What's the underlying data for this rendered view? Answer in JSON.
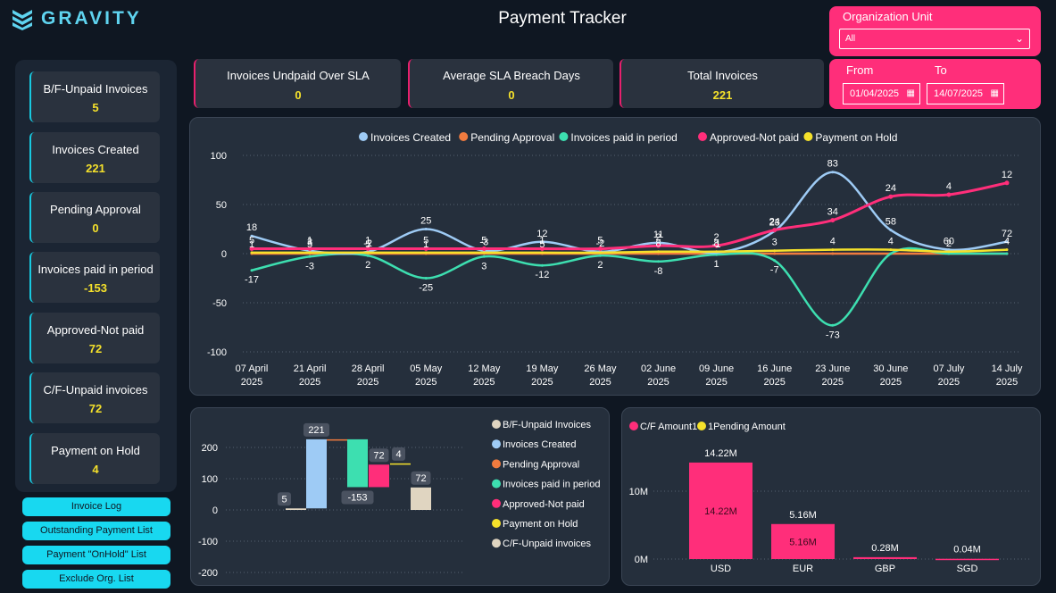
{
  "brand": {
    "name": "GRAVITY"
  },
  "title": "Payment Tracker",
  "sidebar_kpis": [
    {
      "label": "B/F-Unpaid Invoices",
      "value": "5"
    },
    {
      "label": "Invoices Created",
      "value": "221"
    },
    {
      "label": "Pending Approval",
      "value": "0"
    },
    {
      "label": "Invoices paid in period",
      "value": "-153"
    },
    {
      "label": "Approved-Not paid",
      "value": "72"
    },
    {
      "label": "C/F-Unpaid invoices",
      "value": "72"
    },
    {
      "label": "Payment on Hold",
      "value": "4"
    }
  ],
  "nav_buttons": [
    "Invoice Log",
    "Outstanding Payment List",
    "Payment \"OnHold\" List",
    "Exclude Org. List"
  ],
  "top_kpis": [
    {
      "label": "Invoices Undpaid Over SLA",
      "value": "0"
    },
    {
      "label": "Average SLA Breach Days",
      "value": "0"
    },
    {
      "label": "Total Invoices",
      "value": "221"
    }
  ],
  "org_unit": {
    "label": "Organization Unit",
    "value": "All"
  },
  "date_range": {
    "from_label": "From",
    "to_label": "To",
    "from": "01/04/2025",
    "to": "14/07/2025"
  },
  "colors": {
    "invoices_created": "#9ecbf5",
    "pending_approval": "#f07b3f",
    "paid_in_period": "#3ddfb0",
    "approved_not_paid": "#ff2e7a",
    "on_hold": "#f5e12b",
    "bf_unpaid": "#e0d5c1",
    "cf_unpaid": "#e0d5c1",
    "accent_pink": "#ff2e7a",
    "value_yellow": "#f5e12b",
    "cyan": "#18d8f0"
  },
  "chart_data": [
    {
      "type": "line",
      "legend": [
        "Invoices Created",
        "Pending Approval",
        "Invoices paid in period",
        "Approved-Not paid",
        "Payment on Hold"
      ],
      "x": [
        "07 April|2025",
        "21 April|2025",
        "28 April|2025",
        "05 May|2025",
        "12 May|2025",
        "19 May|2025",
        "26 May|2025",
        "02 June|2025",
        "09 June|2025",
        "16 June|2025",
        "23 June|2025",
        "30 June|2025",
        "07 July|2025",
        "14 July|2025"
      ],
      "ylim": [
        -100,
        100
      ],
      "yticks": [
        100,
        50,
        0,
        -50,
        -100
      ],
      "series": [
        {
          "name": "Invoices Created",
          "values": [
            18,
            3,
            2,
            25,
            3,
            12,
            2,
            11,
            1,
            23,
            83,
            24,
            4,
            12
          ]
        },
        {
          "name": "Pending Approval",
          "values": [
            0,
            0,
            0,
            0,
            0,
            0,
            0,
            0,
            0,
            0,
            0,
            0,
            0,
            0
          ]
        },
        {
          "name": "Invoices paid in period",
          "values": [
            -17,
            -3,
            -2,
            -25,
            -3,
            -12,
            -2,
            -8,
            -1,
            -7,
            -73,
            0,
            0,
            0
          ]
        },
        {
          "name": "Approved-Not paid",
          "values": [
            5,
            5,
            5,
            5,
            5,
            5,
            5,
            8,
            8,
            24,
            34,
            58,
            60,
            72
          ]
        },
        {
          "name": "Payment on Hold",
          "values": [
            1,
            1,
            1,
            1,
            1,
            1,
            1,
            2,
            2,
            3,
            4,
            4,
            2,
            4
          ]
        }
      ],
      "labels": [
        [
          "18",
          "5",
          "1",
          "-17"
        ],
        [
          "3",
          "1",
          "5",
          "-3"
        ],
        [
          "-2",
          "1",
          "5",
          "2"
        ],
        [
          "25",
          "5",
          "1",
          "-25"
        ],
        [
          "-3",
          "5",
          "3"
        ],
        [
          "12",
          "1",
          "5",
          "-12"
        ],
        [
          "-2",
          "5",
          "2"
        ],
        [
          "11",
          "2",
          "8",
          "-8"
        ],
        [
          "-1",
          "2",
          "8",
          "1"
        ],
        [
          "23",
          "24",
          "3",
          "-7"
        ],
        [
          "83",
          "34",
          "4",
          "-73"
        ],
        [
          "58",
          "24",
          "4"
        ],
        [
          "60",
          "4",
          "2"
        ],
        [
          "72",
          "12",
          "4"
        ]
      ]
    },
    {
      "type": "bar",
      "subtype": "waterfall",
      "categories": [
        "B/F-Unpaid Invoices",
        "Invoices Created",
        "Pending Approval",
        "Invoices paid in period",
        "Approved-Not paid",
        "Payment on Hold",
        "C/F-Unpaid invoices"
      ],
      "values": [
        5,
        221,
        0,
        -153,
        72,
        4,
        72
      ],
      "value_labels": [
        "5",
        "221",
        "",
        "-153",
        "72",
        "4",
        "72"
      ],
      "ylim": [
        -200,
        200
      ],
      "yticks": [
        200,
        100,
        0,
        -100,
        -200
      ]
    },
    {
      "type": "bar",
      "legend": [
        "C/F Amount1",
        "1Pending Amount"
      ],
      "categories": [
        "USD",
        "EUR",
        "GBP",
        "SGD"
      ],
      "series": [
        {
          "name": "C/F Amount1",
          "values": [
            14.22,
            5.16,
            0.28,
            0.04
          ],
          "labels": [
            "14.22M",
            "5.16M",
            "0.28M",
            "0.04M"
          ],
          "inner_labels": [
            "14.22M",
            "5.16M",
            "",
            ""
          ]
        },
        {
          "name": "1Pending Amount",
          "values": [
            0,
            0,
            0,
            0
          ]
        }
      ],
      "yticks": [
        "10M",
        "0M"
      ],
      "ylim": [
        0,
        16
      ]
    }
  ]
}
